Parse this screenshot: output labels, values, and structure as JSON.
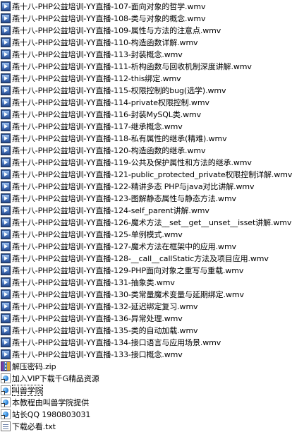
{
  "files": [
    {
      "name": "燕十八-PHP公益培训-YY直播-107-面向对象的哲学.wmv",
      "icon": "video-file-icon"
    },
    {
      "name": "燕十八-PHP公益培训-YY直播-108-类与对象的概念.wmv",
      "icon": "video-file-icon"
    },
    {
      "name": "燕十八-PHP公益培训-YY直播-109-属性与方法的注意点.wmv",
      "icon": "video-file-icon"
    },
    {
      "name": "燕十八-PHP公益培训-YY直播-110-构造函数详解.wmv",
      "icon": "video-file-icon"
    },
    {
      "name": "燕十八-PHP公益培训-YY直播-113-封装概念.wmv",
      "icon": "video-file-icon"
    },
    {
      "name": "燕十八-PHP公益培训-YY直播-111-析构函数与回收机制深度讲解.wmv",
      "icon": "video-file-icon"
    },
    {
      "name": "燕十八-PHP公益培训-YY直播-112-this绑定.wmv",
      "icon": "video-file-icon"
    },
    {
      "name": "燕十八-PHP公益培训-YY直播-115-权限控制的bug(选学).wmv",
      "icon": "video-file-icon"
    },
    {
      "name": "燕十八-PHP公益培训-YY直播-114-private权限控制.wmv",
      "icon": "video-file-icon"
    },
    {
      "name": "燕十八-PHP公益培训-YY直播-116-封装MySQL类.wmv",
      "icon": "video-file-icon"
    },
    {
      "name": "燕十八-PHP公益培训-YY直播-117-继承概念.wmv",
      "icon": "video-file-icon"
    },
    {
      "name": "燕十八-PHP公益培训-YY直播-118-私有属性的继承(精难).wmv",
      "icon": "video-file-icon"
    },
    {
      "name": "燕十八-PHP公益培训-YY直播-120-构造函数的继承.wmv",
      "icon": "video-file-icon"
    },
    {
      "name": "燕十八-PHP公益培训-YY直播-119-公共及保护属性和方法的继承.wmv",
      "icon": "video-file-icon"
    },
    {
      "name": "燕十八-PHP公益培训-YY直播-121-public_protected_private权限控制详解.wmv",
      "icon": "video-file-icon"
    },
    {
      "name": "燕十八-PHP公益培训-YY直播-122-精讲多态 PHP与java对比讲解.wmv",
      "icon": "video-file-icon"
    },
    {
      "name": "燕十八-PHP公益培训-YY直播-123-图解静态属性与静态方法.wmv",
      "icon": "video-file-icon"
    },
    {
      "name": "燕十八-PHP公益培训-YY直播-124-self_parent讲解.wmv",
      "icon": "video-file-icon"
    },
    {
      "name": "燕十八-PHP公益培训-YY直播-126-魔术方法__set__get__unset__isset讲解.wmv",
      "icon": "video-file-icon"
    },
    {
      "name": "燕十八-PHP公益培训-YY直播-125-单例模式.wmv",
      "icon": "video-file-icon"
    },
    {
      "name": "燕十八-PHP公益培训-YY直播-127-魔术方法在框架中的应用.wmv",
      "icon": "video-file-icon"
    },
    {
      "name": "燕十八-PHP公益培训-YY直播-128-__call__callStatic方法及项目应用.wmv",
      "icon": "video-file-icon"
    },
    {
      "name": "燕十八-PHP公益培训-YY直播-129-PHP面向对象之重写与重载.wmv",
      "icon": "video-file-icon"
    },
    {
      "name": "燕十八-PHP公益培训-YY直播-131-抽象类.wmv",
      "icon": "video-file-icon"
    },
    {
      "name": "燕十八-PHP公益培训-YY直播-130-类常量魔术变量与延期绑定.wmv",
      "icon": "video-file-icon"
    },
    {
      "name": "燕十八-PHP公益培训-YY直播-132-延迟绑定复习.wmv",
      "icon": "video-file-icon"
    },
    {
      "name": "燕十八-PHP公益培训-YY直播-136-异常处理.wmv",
      "icon": "video-file-icon"
    },
    {
      "name": "燕十八-PHP公益培训-YY直播-135-类的自动加载.wmv",
      "icon": "video-file-icon"
    },
    {
      "name": "燕十八-PHP公益培训-YY直播-134-接口语言与应用场景.wmv",
      "icon": "video-file-icon"
    },
    {
      "name": "燕十八-PHP公益培训-YY直播-133-接口概念.wmv",
      "icon": "video-file-icon"
    },
    {
      "name": "解压密码.zip",
      "icon": "zip-archive-icon"
    },
    {
      "name": "加入VIP下载千G精品资源",
      "icon": "internet-shortcut-icon"
    },
    {
      "name": "叫兽学院",
      "icon": "internet-shortcut-icon",
      "focused": true
    },
    {
      "name": "本教程由叫兽学院提供",
      "icon": "internet-shortcut-icon"
    },
    {
      "name": "站长QQ 1980803031",
      "icon": "internet-shortcut-icon"
    },
    {
      "name": "下载必看.txt",
      "icon": "text-file-icon"
    }
  ]
}
